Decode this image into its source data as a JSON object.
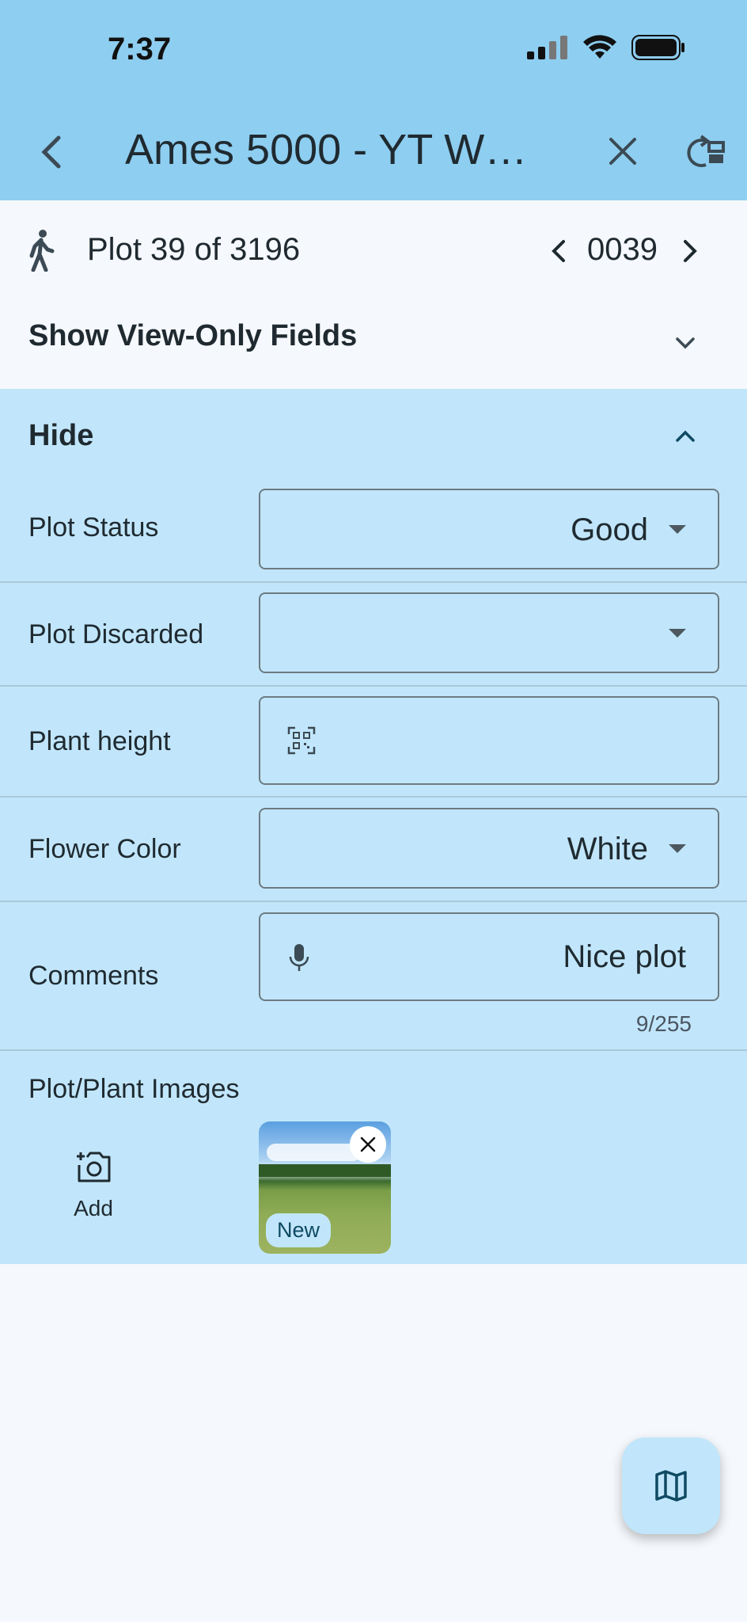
{
  "status_bar": {
    "time": "7:37"
  },
  "header": {
    "title": "Ames 5000 - YT Wit…"
  },
  "plot_nav": {
    "position_text": "Plot 39 of 3196",
    "plot_number": "0039"
  },
  "view_only": {
    "label": "Show View-Only Fields"
  },
  "panel": {
    "hide_label": "Hide"
  },
  "fields": {
    "plot_status": {
      "label": "Plot Status",
      "value": "Good"
    },
    "plot_discarded": {
      "label": "Plot Discarded",
      "value": ""
    },
    "plant_height": {
      "label": "Plant height",
      "value": ""
    },
    "flower_color": {
      "label": "Flower Color",
      "value": "White"
    },
    "comments": {
      "label": "Comments",
      "value": "Nice plot",
      "counter": "9/255"
    }
  },
  "images": {
    "label": "Plot/Plant Images",
    "add_label": "Add",
    "thumbnail_badge": "New"
  },
  "colors": {
    "header_bg": "#8ecef0",
    "panel_bg": "#c1e6fb",
    "page_bg": "#f5f8fc",
    "accent": "#0f4a63"
  },
  "icons": [
    "back-arrow-icon",
    "close-icon",
    "switch-icon",
    "walk-icon",
    "chevron-left-icon",
    "chevron-right-icon",
    "chevron-down-icon",
    "chevron-up-icon",
    "qr-scan-icon",
    "microphone-icon",
    "add-photo-icon",
    "map-icon"
  ]
}
